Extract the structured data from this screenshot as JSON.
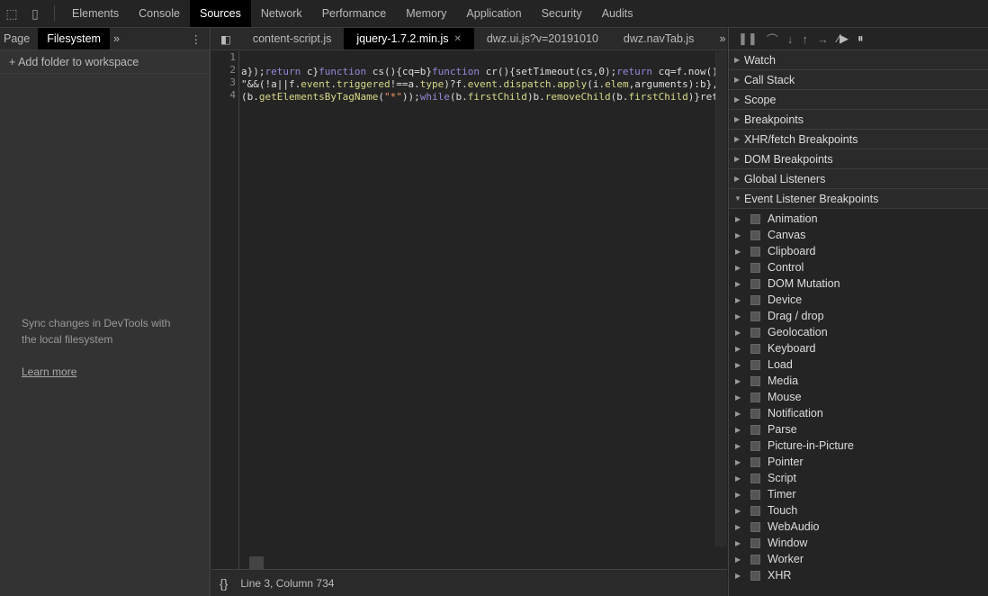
{
  "topbar": {
    "tabs": [
      "Elements",
      "Console",
      "Sources",
      "Network",
      "Performance",
      "Memory",
      "Application",
      "Security",
      "Audits"
    ],
    "active": "Sources"
  },
  "navigator": {
    "tabs": [
      "Page",
      "Filesystem"
    ],
    "active": "Filesystem",
    "add_folder": "Add folder to workspace",
    "sync_text": "Sync changes in DevTools with the local filesystem",
    "learn_more": "Learn more"
  },
  "editor": {
    "tabs": [
      "content-script.js",
      "jquery-1.7.2.min.js",
      "dwz.ui.js?v=20191010",
      "dwz.navTab.js"
    ],
    "active": "jquery-1.7.2.min.js",
    "line_numbers": [
      "1",
      "2",
      "3",
      "4"
    ],
    "lines": [
      [],
      [
        [
          "a});",
          "d"
        ],
        [
          "return",
          "k"
        ],
        [
          " c}",
          "d"
        ],
        [
          "function",
          "k"
        ],
        [
          " cs(){cq=b}",
          "d"
        ],
        [
          "function",
          "k"
        ],
        [
          " cr(){setTimeout(cs,0);",
          "d"
        ],
        [
          "return",
          "k"
        ],
        [
          " cq=f.now()",
          "d"
        ]
      ],
      [
        [
          "\"&&(!a||f.",
          "d"
        ],
        [
          "event",
          "p"
        ],
        [
          ".",
          "d"
        ],
        [
          "triggered",
          "p"
        ],
        [
          "!==a.",
          "d"
        ],
        [
          "type",
          "p"
        ],
        [
          ")?f.",
          "d"
        ],
        [
          "event",
          "p"
        ],
        [
          ".",
          "d"
        ],
        [
          "dispatch",
          "p"
        ],
        [
          ".",
          "d"
        ],
        [
          "apply",
          "p"
        ],
        [
          "(i.",
          "d"
        ],
        [
          "elem",
          "p"
        ],
        [
          ",arguments):b},",
          "d"
        ]
      ],
      [
        [
          "(b.",
          "d"
        ],
        [
          "getElementsByTagName",
          "p"
        ],
        [
          "(",
          "d"
        ],
        [
          "\"*\"",
          "s"
        ],
        [
          "));",
          "d"
        ],
        [
          "while",
          "k"
        ],
        [
          "(b.",
          "d"
        ],
        [
          "firstChild",
          "p"
        ],
        [
          ")b.",
          "d"
        ],
        [
          "removeChild",
          "p"
        ],
        [
          "(b.",
          "d"
        ],
        [
          "firstChild",
          "p"
        ],
        [
          ")}ret",
          "d"
        ]
      ]
    ],
    "status": "Line 3, Column 734"
  },
  "debugger": {
    "sections": [
      "Watch",
      "Call Stack",
      "Scope",
      "Breakpoints",
      "XHR/fetch Breakpoints",
      "DOM Breakpoints",
      "Global Listeners",
      "Event Listener Breakpoints"
    ],
    "event_listeners": [
      "Animation",
      "Canvas",
      "Clipboard",
      "Control",
      "DOM Mutation",
      "Device",
      "Drag / drop",
      "Geolocation",
      "Keyboard",
      "Load",
      "Media",
      "Mouse",
      "Notification",
      "Parse",
      "Picture-in-Picture",
      "Pointer",
      "Script",
      "Timer",
      "Touch",
      "WebAudio",
      "Window",
      "Worker",
      "XHR"
    ]
  }
}
